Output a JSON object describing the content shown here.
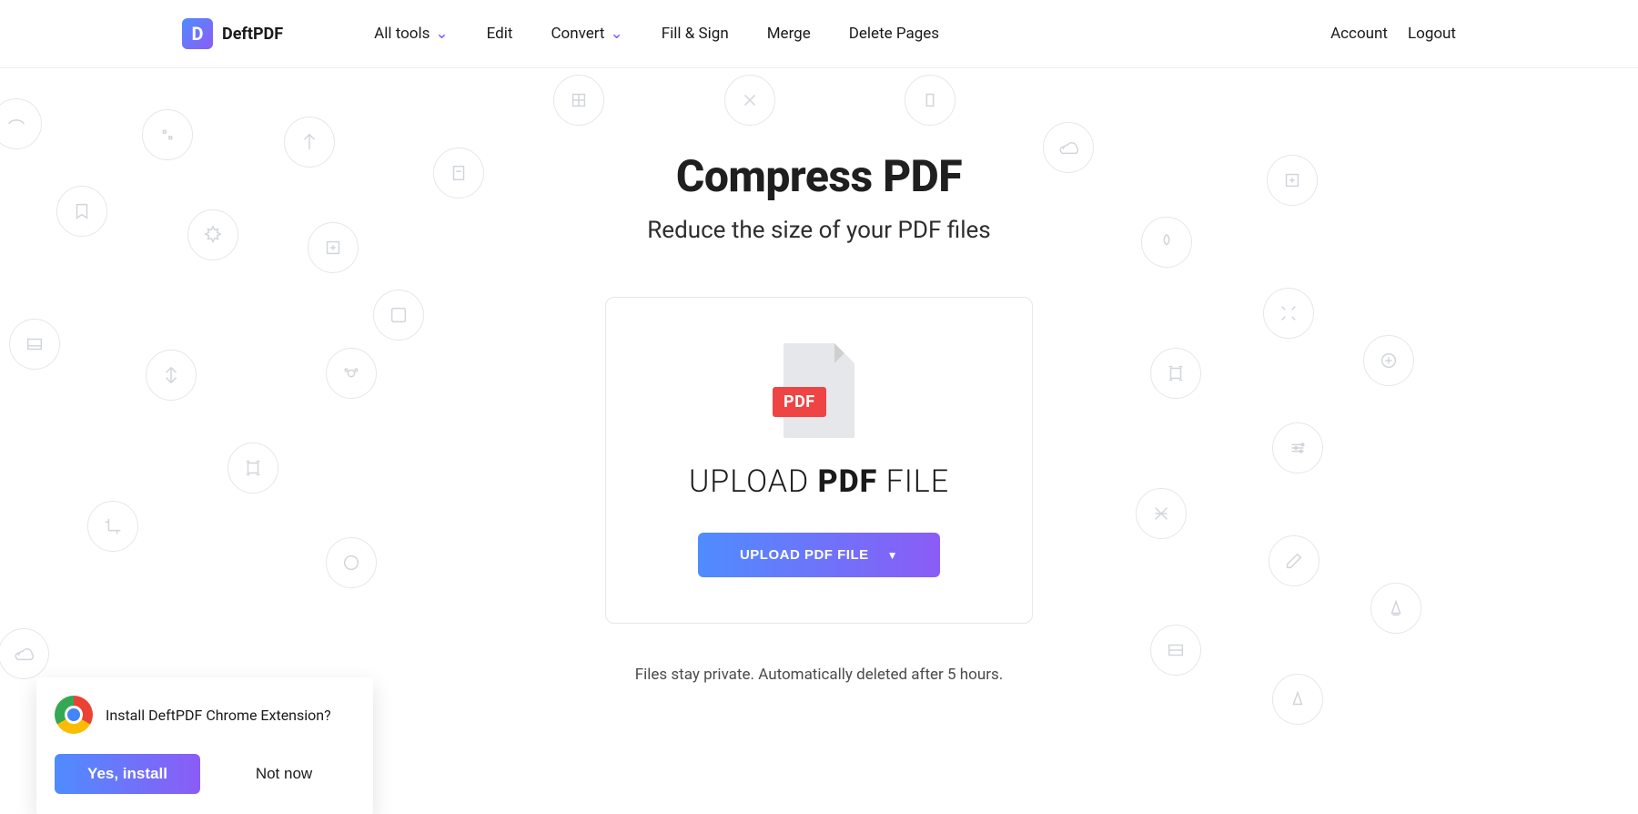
{
  "header": {
    "brand_letter": "D",
    "brand_name": "DeftPDF",
    "nav": {
      "all_tools": "All tools",
      "edit": "Edit",
      "convert": "Convert",
      "fill_sign": "Fill & Sign",
      "merge": "Merge",
      "delete_pages": "Delete Pages"
    },
    "account": "Account",
    "logout": "Logout"
  },
  "main": {
    "title": "Compress PDF",
    "subtitle": "Reduce the size of your PDF files",
    "pdf_badge": "PDF",
    "upload_text_pre": "UPLOAD ",
    "upload_text_bold": "PDF",
    "upload_text_post": " FILE",
    "upload_button": "UPLOAD PDF FILE",
    "privacy": "Files stay private. Automatically deleted after 5 hours."
  },
  "extension_popup": {
    "message": "Install DeftPDF Chrome Extension?",
    "yes": "Yes, install",
    "no": "Not now"
  }
}
